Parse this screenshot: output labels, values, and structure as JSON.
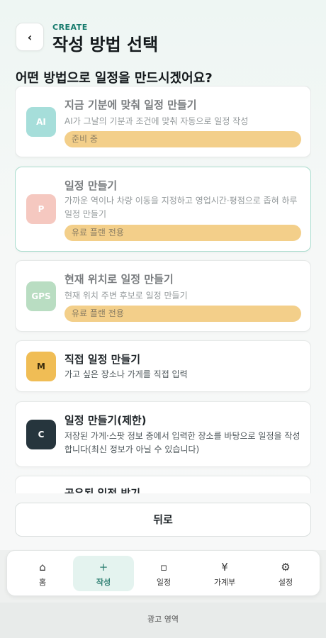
{
  "header": {
    "back_icon": "chevron-left-icon",
    "back_glyph": "‹",
    "eyebrow": "CREATE",
    "title": "작성 방법 선택"
  },
  "question": "어떤 방법으로 일정을 만드시겠어요?",
  "cards": [
    {
      "icon_text": "AI",
      "icon_color": "#6cc9c2",
      "title": "지금 기분에 맞춰 일정 만들기",
      "desc": "AI가 그날의 기분과 조건에 맞춰 자동으로 일정 작성",
      "badge": "준비 중"
    },
    {
      "icon_text": "P",
      "icon_color": "#f0a497",
      "title": "일정 만들기",
      "desc": "가까운 역이나 차량 이동을 지정하고 영업시간·평점으로 좁혀 하루 일정 만들기",
      "badge": "유료 플랜 전용"
    },
    {
      "icon_text": "GPS",
      "icon_color": "#8cc79b",
      "title": "현재 위치로 일정 만들기",
      "desc": "현재 위치 주변 후보로 일정 만들기",
      "badge": "유료 플랜 전용"
    },
    {
      "icon_text": "M",
      "icon_color": "#f0bd55",
      "title": "직접 일정 만들기",
      "desc": "가고 싶은 장소나 가게를 직접 입력"
    },
    {
      "icon_text": "C",
      "icon_color": "#26353d",
      "title": "일정 만들기(제한)",
      "desc": "저장된 가게·스팟 정보 중에서 입력한 장소를 바탕으로 일정을 작성합니다(최신 정보가 아닐 수 있습니다)"
    },
    {
      "title": "공유된 일정 받기"
    }
  ],
  "back_button": "뒤로",
  "tabs": [
    {
      "icon": "home-icon",
      "glyph": "⌂",
      "label": "홈"
    },
    {
      "icon": "plus-icon",
      "glyph": "+",
      "label": "작성"
    },
    {
      "icon": "calendar-icon",
      "glyph": "▫",
      "label": "일정"
    },
    {
      "icon": "yen-icon",
      "glyph": "¥",
      "label": "가계부"
    },
    {
      "icon": "gear-icon",
      "glyph": "⚙",
      "label": "설정"
    }
  ],
  "ad_label": "광고 영역"
}
